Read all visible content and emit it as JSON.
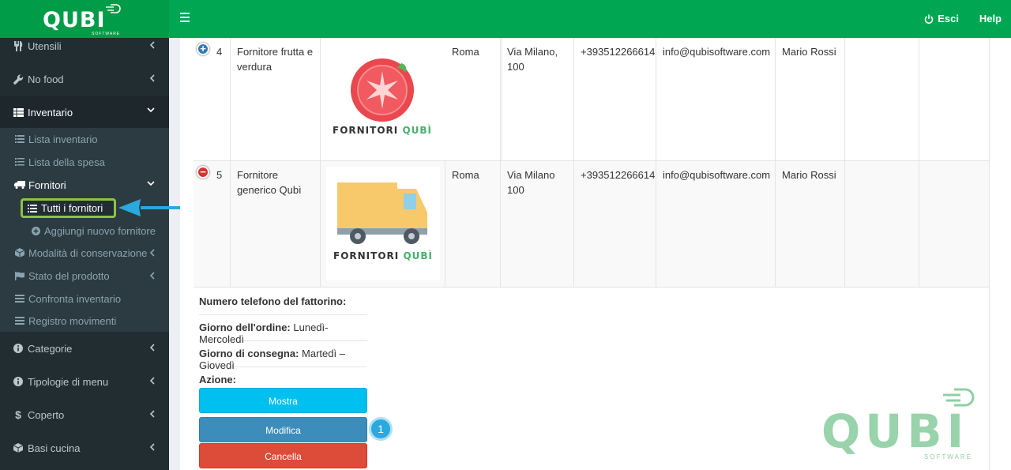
{
  "brand": {
    "logo": "QUBI",
    "sub": "SOFTWARE"
  },
  "header": {
    "esci": "Esci",
    "help": "Help"
  },
  "sidebar": {
    "items": [
      {
        "label": "Utensili",
        "icon": "utensils-icon"
      },
      {
        "label": "No food",
        "icon": "wrench-icon"
      },
      {
        "label": "Inventario",
        "icon": "table-icon"
      },
      {
        "label": "Categorie",
        "icon": "info-icon"
      },
      {
        "label": "Tipologie di menu",
        "icon": "info-icon"
      },
      {
        "label": "Coperto",
        "icon": "dollar-icon"
      },
      {
        "label": "Basi cucina",
        "icon": "cube-icon"
      }
    ],
    "sub": [
      {
        "label": "Lista inventario"
      },
      {
        "label": "Lista della spesa"
      },
      {
        "label": "Fornitori"
      },
      {
        "label": "Tutti i fornitori"
      },
      {
        "label": "Aggiungi nuovo fornitore"
      },
      {
        "label": "Modalità di conservazione"
      },
      {
        "label": "Stato del prodotto"
      },
      {
        "label": "Confronta inventario"
      },
      {
        "label": "Registro movimenti"
      }
    ]
  },
  "table": {
    "rows": [
      {
        "num": "4",
        "name": "Fornitore frutta e verdura",
        "city": "Roma",
        "address": "Via Milano, 100",
        "phone": "+393512266614",
        "email": "info@qubisoftware.com",
        "contact": "Mario Rossi",
        "logo_caption": "FORNITORI",
        "logo_brand": "QUBÌ"
      },
      {
        "num": "5",
        "name": "Fornitore generico Qubì",
        "city": "Roma",
        "address": "Via Milano 100",
        "phone": "+393512266614",
        "email": "info@qubisoftware.com",
        "contact": "Mario Rossi",
        "logo_caption": "FORNITORI",
        "logo_brand": "QUBÌ"
      }
    ]
  },
  "details": {
    "phone_label": "Numero telefono del fattorino:",
    "phone_value": "",
    "order_label": "Giorno dell'ordine:",
    "order_value": "Lunedì-Mercoledì",
    "delivery_label": "Giorno di consegna:",
    "delivery_value": "Martedì –Giovedì",
    "action_label": "Azione:"
  },
  "buttons": {
    "mostra": "Mostra",
    "modifica": "Modifica",
    "cancella": "Cancella"
  },
  "step_badge": "1",
  "watermark": {
    "logo": "QUBI",
    "sub": "SOFTWARE"
  },
  "colors": {
    "header": "#00a651",
    "sidebar": "#222d32",
    "highlight": "#8bc34a",
    "arrow": "#29a9dd"
  }
}
